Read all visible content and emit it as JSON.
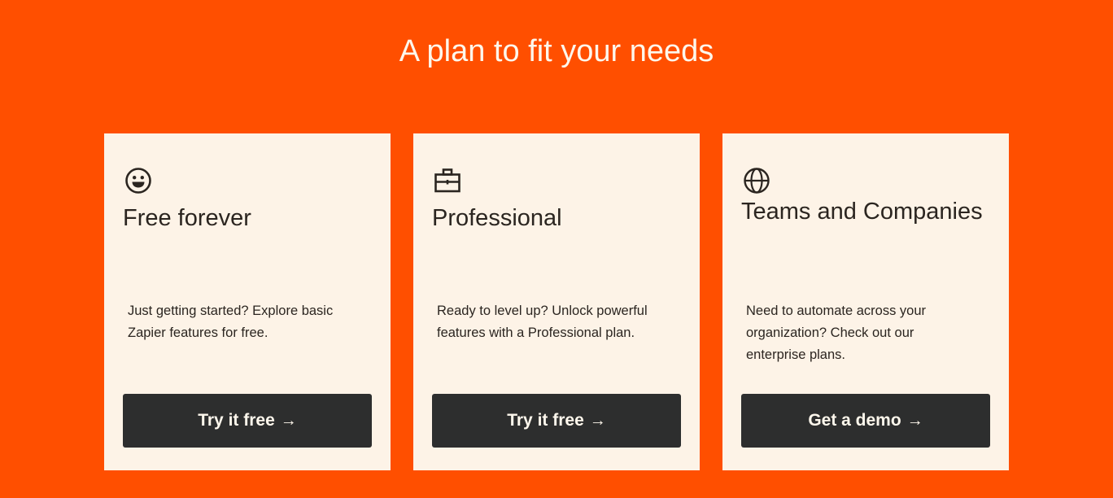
{
  "section": {
    "heading": "A plan to fit your needs"
  },
  "plans": [
    {
      "icon": "smiley-face-icon",
      "title": "Free forever",
      "description": "Just getting started? Explore basic Zapier features for free.",
      "cta_label": "Try it free",
      "cta_arrow": "→"
    },
    {
      "icon": "briefcase-icon",
      "title": "Professional",
      "description": "Ready to level up? Unlock powerful features with a Professional plan.",
      "cta_label": "Try it free",
      "cta_arrow": "→"
    },
    {
      "icon": "globe-icon",
      "title": "Teams and Companies",
      "description": "Need to automate across your organization? Check out our enterprise plans.",
      "cta_label": "Get a demo",
      "cta_arrow": "→"
    }
  ],
  "colors": {
    "background": "#ff4f00",
    "card": "#fdf3e7",
    "button": "#2d2e2e",
    "text_dark": "#2b2520",
    "text_light": "#fdf7ec"
  }
}
